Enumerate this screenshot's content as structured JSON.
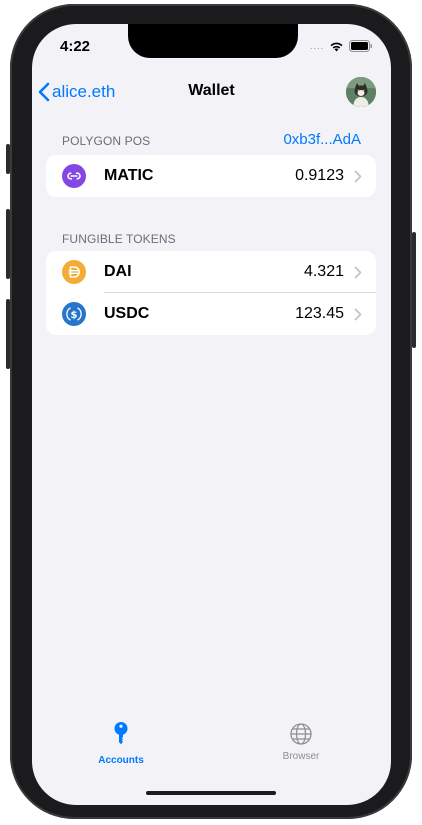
{
  "status_bar": {
    "time": "4:22",
    "signal": "....",
    "icons": [
      "wifi-icon",
      "battery-icon"
    ]
  },
  "nav": {
    "back_label": "alice.eth",
    "title": "Wallet",
    "avatar": "profile-avatar"
  },
  "network_section": {
    "header": "POLYGON POS",
    "address": "0xb3f...AdA",
    "items": [
      {
        "icon": "matic-icon",
        "symbol": "MATIC",
        "balance": "0.9123"
      }
    ]
  },
  "tokens_section": {
    "header": "FUNGIBLE TOKENS",
    "items": [
      {
        "icon": "dai-icon",
        "symbol": "DAI",
        "balance": "4.321"
      },
      {
        "icon": "usdc-icon",
        "symbol": "USDC",
        "balance": "123.45"
      }
    ]
  },
  "tab_bar": {
    "tabs": [
      {
        "icon": "key-icon",
        "label": "Accounts",
        "active": true
      },
      {
        "icon": "globe-icon",
        "label": "Browser",
        "active": false
      }
    ]
  },
  "colors": {
    "accent": "#007aff",
    "background": "#f2f2f7",
    "matic": "#8247e5",
    "dai": "#f5ac37",
    "usdc": "#2775ca",
    "inactive": "#8e8e93"
  }
}
